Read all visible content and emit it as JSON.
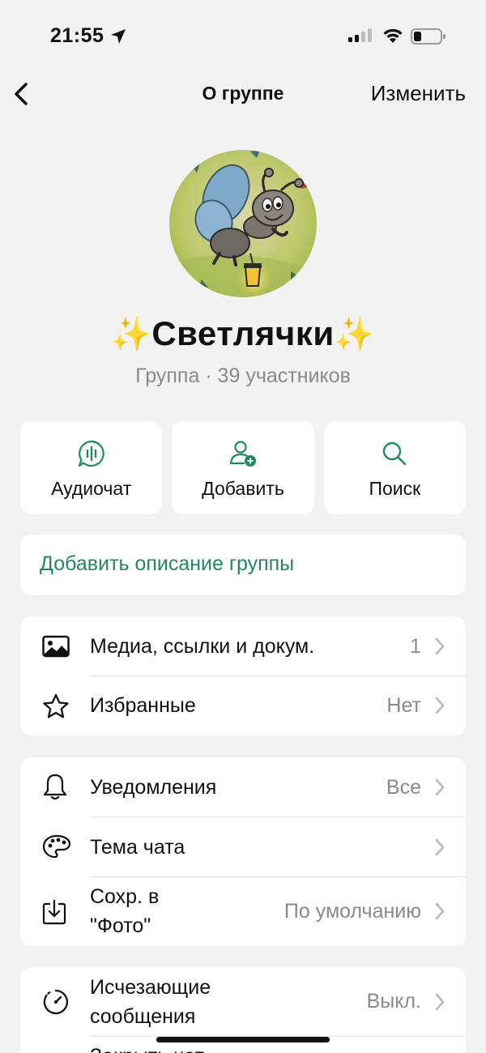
{
  "status_bar": {
    "time": "21:55"
  },
  "nav": {
    "title": "О группе",
    "edit_label": "Изменить"
  },
  "group": {
    "name": "Светлячки",
    "sparkle": "✨",
    "subtitle": "Группа · 39 участников"
  },
  "actions": [
    {
      "label": "Аудиочат",
      "icon": "audio-chat-icon"
    },
    {
      "label": "Добавить",
      "icon": "add-participant-icon"
    },
    {
      "label": "Поиск",
      "icon": "search-icon"
    }
  ],
  "description": {
    "link": "Добавить описание группы"
  },
  "section1": [
    {
      "label": "Медиа, ссылки и докум.",
      "value": "1",
      "icon": "image-icon"
    },
    {
      "label": "Избранные",
      "value": "Нет",
      "icon": "star-icon"
    }
  ],
  "section2": [
    {
      "label": "Уведомления",
      "value": "Все",
      "icon": "bell-icon"
    },
    {
      "label": "Тема чата",
      "value": "",
      "icon": "palette-icon"
    },
    {
      "label_line1": "Сохр. в",
      "label_line2": "\"Фото\"",
      "value": "По умолчанию",
      "icon": "download-icon"
    }
  ],
  "section3": [
    {
      "label_line1": "Исчезающие",
      "label_line2": "сообщения",
      "value": "Выкл.",
      "icon": "timer-icon"
    },
    {
      "label": "Закрыть чат"
    }
  ],
  "colors": {
    "accent": "#1f8a5b",
    "background": "#f2f2f2",
    "secondary_text": "#8a8a8e"
  }
}
